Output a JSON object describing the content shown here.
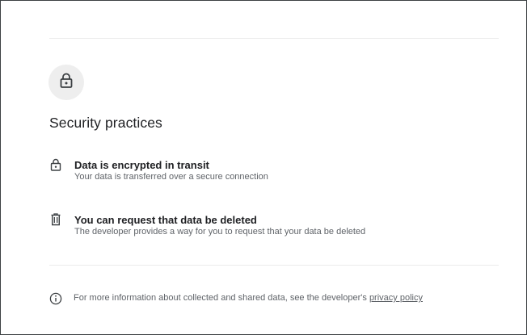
{
  "section": {
    "title": "Security practices",
    "header_icon": "lock-icon"
  },
  "practices": [
    {
      "icon": "lock-icon",
      "title": "Data is encrypted in transit",
      "description": "Your data is transferred over a secure connection"
    },
    {
      "icon": "trash-icon",
      "title": "You can request that data be deleted",
      "description": "The developer provides a way for you to request that your data be deleted"
    }
  ],
  "footer": {
    "icon": "info-icon",
    "text": "For more information about collected and shared data, see the developer's ",
    "link_label": "privacy policy"
  },
  "colors": {
    "text_primary": "#202124",
    "text_secondary": "#5f6368",
    "icon_circle_bg": "#eeeeee",
    "divider": "#ebebeb"
  }
}
